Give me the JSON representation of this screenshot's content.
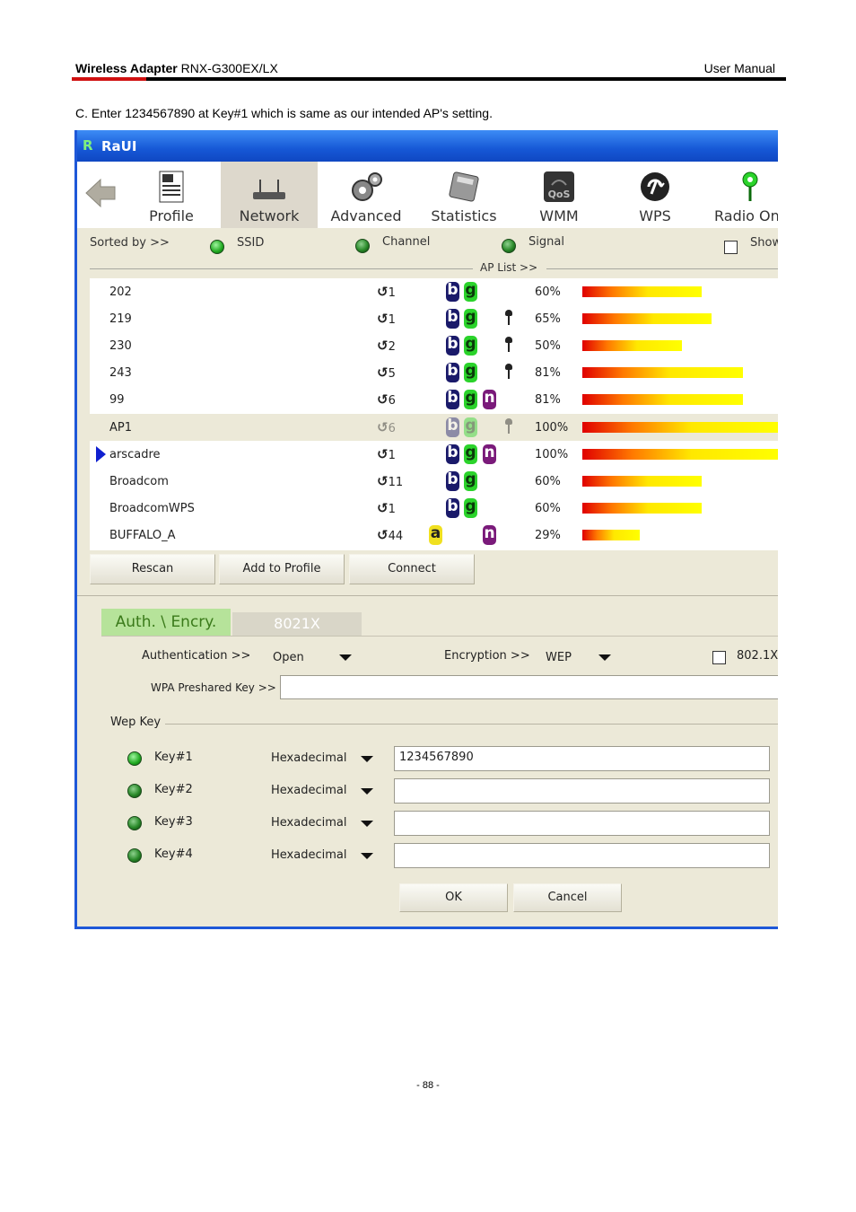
{
  "doc": {
    "header_bold": "Wireless Adapter",
    "header_model": "RNX-G300EX/LX",
    "header_right": "User Manual",
    "instruction": "C. Enter 1234567890 at Key#1 which is same as our intended AP's setting.",
    "footer": "- 88 -"
  },
  "window": {
    "title": "RaUI",
    "toolbar": [
      {
        "label": "Profile",
        "icon": "profile-icon"
      },
      {
        "label": "Network",
        "icon": "network-icon",
        "active": true
      },
      {
        "label": "Advanced",
        "icon": "gears-icon"
      },
      {
        "label": "Statistics",
        "icon": "calculator-icon"
      },
      {
        "label": "WMM",
        "icon": "qos-icon"
      },
      {
        "label": "WPS",
        "icon": "wps-icon"
      },
      {
        "label": "Radio On/",
        "icon": "radio-icon"
      }
    ],
    "sort": {
      "label": "Sorted by >>",
      "ssid": "SSID",
      "channel": "Channel",
      "signal": "Signal",
      "show": "Show",
      "ap_list": "AP List >>"
    },
    "aps": [
      {
        "ssid": "202",
        "channel": "1",
        "modes": [
          "b",
          "g"
        ],
        "locked": false,
        "signal": "60%",
        "signal_value": 0.6
      },
      {
        "ssid": "219",
        "channel": "1",
        "modes": [
          "b",
          "g"
        ],
        "locked": true,
        "signal": "65%",
        "signal_value": 0.65
      },
      {
        "ssid": "230",
        "channel": "2",
        "modes": [
          "b",
          "g"
        ],
        "locked": true,
        "signal": "50%",
        "signal_value": 0.5
      },
      {
        "ssid": "243",
        "channel": "5",
        "modes": [
          "b",
          "g"
        ],
        "locked": true,
        "signal": "81%",
        "signal_value": 0.81
      },
      {
        "ssid": "99",
        "channel": "6",
        "modes": [
          "b",
          "g",
          "n"
        ],
        "locked": false,
        "signal": "81%",
        "signal_value": 0.81
      },
      {
        "ssid": "AP1",
        "channel": "6",
        "modes": [
          "b",
          "g"
        ],
        "locked": true,
        "signal": "100%",
        "signal_value": 1.0,
        "selected": true
      },
      {
        "ssid": "arscadre",
        "channel": "1",
        "modes": [
          "b",
          "g",
          "n"
        ],
        "locked": false,
        "signal": "100%",
        "signal_value": 1.0,
        "connected": true
      },
      {
        "ssid": "Broadcom",
        "channel": "11",
        "modes": [
          "b",
          "g"
        ],
        "locked": false,
        "signal": "60%",
        "signal_value": 0.6
      },
      {
        "ssid": "BroadcomWPS",
        "channel": "1",
        "modes": [
          "b",
          "g"
        ],
        "locked": false,
        "signal": "60%",
        "signal_value": 0.6
      },
      {
        "ssid": "BUFFALO_A",
        "channel": "44",
        "modes": [
          "a",
          "n"
        ],
        "locked": false,
        "signal": "29%",
        "signal_value": 0.29
      }
    ],
    "buttons": {
      "rescan": "Rescan",
      "add_profile": "Add to Profile",
      "connect": "Connect"
    },
    "tabs": {
      "auth": "Auth. \\ Encry.",
      "dot1x": "8021X"
    },
    "auth": {
      "auth_label": "Authentication >>",
      "auth_value": "Open",
      "enc_label": "Encryption >>",
      "enc_value": "WEP",
      "dot1x_label": "802.1X",
      "wpa_label": "WPA Preshared Key >>",
      "wpa_value": "",
      "wep_label": "Wep Key"
    },
    "keys": [
      {
        "label": "Key#1",
        "format": "Hexadecimal",
        "value": "1234567890"
      },
      {
        "label": "Key#2",
        "format": "Hexadecimal",
        "value": ""
      },
      {
        "label": "Key#3",
        "format": "Hexadecimal",
        "value": ""
      },
      {
        "label": "Key#4",
        "format": "Hexadecimal",
        "value": ""
      }
    ],
    "ok": "OK",
    "cancel": "Cancel"
  }
}
